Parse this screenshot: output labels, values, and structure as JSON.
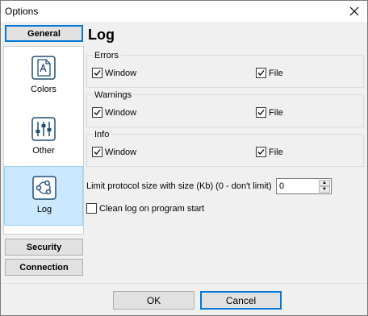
{
  "window": {
    "title": "Options"
  },
  "nav": {
    "general": "General",
    "security": "Security",
    "connection": "Connection",
    "items": [
      {
        "label": "Colors",
        "icon": "font-file-icon"
      },
      {
        "label": "Other",
        "icon": "sliders-icon"
      },
      {
        "label": "Log",
        "icon": "network-nodes-icon",
        "selected": true
      }
    ]
  },
  "page": {
    "title": "Log",
    "groups": [
      {
        "legend": "Errors",
        "window_label": "Window",
        "window_checked": true,
        "file_label": "File",
        "file_checked": true
      },
      {
        "legend": "Warnings",
        "window_label": "Window",
        "window_checked": true,
        "file_label": "File",
        "file_checked": true
      },
      {
        "legend": "Info",
        "window_label": "Window",
        "window_checked": true,
        "file_label": "File",
        "file_checked": true
      }
    ],
    "limit_label": "Limit protocol size with size (Kb) (0 - don't limit)",
    "limit_value": "0",
    "clean_log_label": "Clean log on program start",
    "clean_log_checked": false
  },
  "buttons": {
    "ok": "OK",
    "cancel": "Cancel"
  },
  "colors": {
    "selected_bg": "#cce8ff",
    "accent": "#0078d7",
    "icon": "#1f4e79"
  }
}
